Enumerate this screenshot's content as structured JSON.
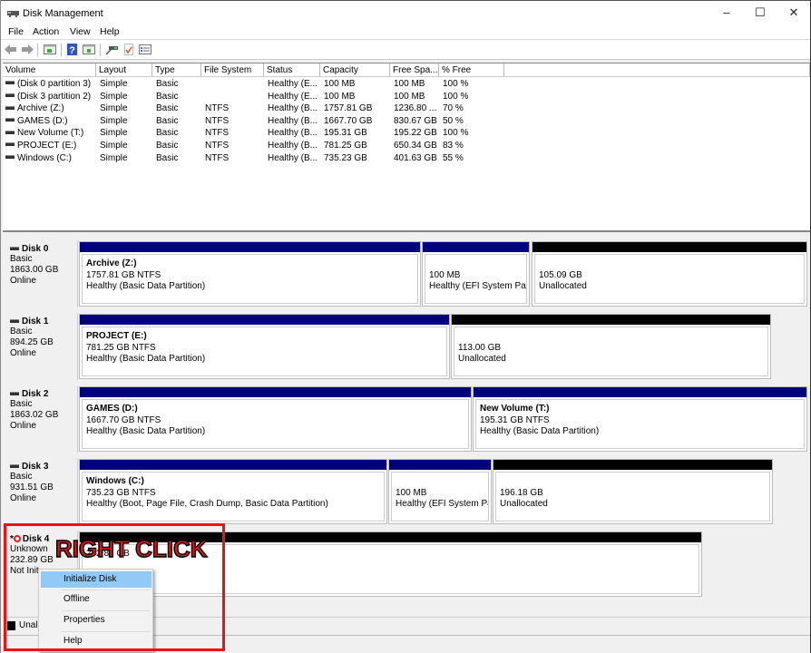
{
  "window": {
    "title": "Disk Management",
    "controls": {
      "minimize": "–",
      "maximize": "☐",
      "close": "✕"
    }
  },
  "menu": [
    "File",
    "Action",
    "View",
    "Help"
  ],
  "toolbar": {
    "icons": [
      "back-arrow-icon",
      "forward-arrow-icon",
      "show-hide-console-tree-icon",
      "help-icon",
      "show-hide-action-pane-icon",
      "connect-disk-icon",
      "checklist-icon",
      "properties-icon"
    ]
  },
  "volume_list": {
    "columns": [
      "Volume",
      "Layout",
      "Type",
      "File System",
      "Status",
      "Capacity",
      "Free Spa...",
      "% Free"
    ],
    "rows": [
      [
        "(Disk 0 partition 3)",
        "Simple",
        "Basic",
        "",
        "Healthy (E...",
        "100 MB",
        "100 MB",
        "100 %"
      ],
      [
        "(Disk 3 partition 2)",
        "Simple",
        "Basic",
        "",
        "Healthy (E...",
        "100 MB",
        "100 MB",
        "100 %"
      ],
      [
        "Archive (Z:)",
        "Simple",
        "Basic",
        "NTFS",
        "Healthy (B...",
        "1757.81 GB",
        "1236.80 ...",
        "70 %"
      ],
      [
        "GAMES (D:)",
        "Simple",
        "Basic",
        "NTFS",
        "Healthy (B...",
        "1667.70 GB",
        "830.67 GB",
        "50 %"
      ],
      [
        "New Volume (T:)",
        "Simple",
        "Basic",
        "NTFS",
        "Healthy (B...",
        "195.31 GB",
        "195.22 GB",
        "100 %"
      ],
      [
        "PROJECT (E:)",
        "Simple",
        "Basic",
        "NTFS",
        "Healthy (B...",
        "781.25 GB",
        "650.34 GB",
        "83 %"
      ],
      [
        "Windows (C:)",
        "Simple",
        "Basic",
        "NTFS",
        "Healthy (B...",
        "735.23 GB",
        "401.63 GB",
        "55 %"
      ]
    ]
  },
  "disks": [
    {
      "name": "Disk 0",
      "type": "Basic",
      "size": "1863.00 GB",
      "status": "Online",
      "partitions": [
        {
          "title": "Archive  (Z:)",
          "line1": "1757.81 GB NTFS",
          "line2": "Healthy (Basic Data Partition)",
          "bar": "blue"
        },
        {
          "title": "",
          "line1": "100 MB",
          "line2": "Healthy (EFI System Partit",
          "bar": "blue"
        },
        {
          "title": "",
          "line1": "105.09 GB",
          "line2": "Unallocated",
          "bar": "black"
        }
      ]
    },
    {
      "name": "Disk 1",
      "type": "Basic",
      "size": "894.25 GB",
      "status": "Online",
      "partitions": [
        {
          "title": "PROJECT  (E:)",
          "line1": "781.25 GB NTFS",
          "line2": "Healthy (Basic Data Partition)",
          "bar": "blue"
        },
        {
          "title": "",
          "line1": "113.00 GB",
          "line2": "Unallocated",
          "bar": "black"
        }
      ]
    },
    {
      "name": "Disk 2",
      "type": "Basic",
      "size": "1863.02 GB",
      "status": "Online",
      "partitions": [
        {
          "title": "GAMES  (D:)",
          "line1": "1667.70 GB NTFS",
          "line2": "Healthy (Basic Data Partition)",
          "bar": "blue"
        },
        {
          "title": "New Volume  (T:)",
          "line1": "195.31 GB NTFS",
          "line2": "Healthy (Basic Data Partition)",
          "bar": "blue"
        }
      ]
    },
    {
      "name": "Disk 3",
      "type": "Basic",
      "size": "931.51 GB",
      "status": "Online",
      "partitions": [
        {
          "title": "Windows  (C:)",
          "line1": "735.23 GB NTFS",
          "line2": "Healthy (Boot, Page File, Crash Dump, Basic Data Partition)",
          "bar": "blue"
        },
        {
          "title": "",
          "line1": "100 MB",
          "line2": "Healthy (EFI System Part",
          "bar": "blue"
        },
        {
          "title": "",
          "line1": "196.18 GB",
          "line2": "Unallocated",
          "bar": "black"
        }
      ]
    },
    {
      "name": "Disk 4",
      "type": "Unknown",
      "size": "232.89 GB",
      "status": "Not Init",
      "partitions": [
        {
          "title": "",
          "line1": "232.89 GB",
          "line2": "",
          "bar": "black"
        }
      ]
    }
  ],
  "legend": {
    "label": "Unall"
  },
  "context_menu": {
    "items": [
      "Initialize Disk",
      "Offline",
      "Properties",
      "Help"
    ],
    "highlighted": "Initialize Disk"
  },
  "annotation": {
    "text": "RIGHT CLICK",
    "color": "#ee1111"
  },
  "colors": {
    "primary_partition": "#00007f",
    "unallocated": "#000000",
    "menu_highlight": "#91c9f7"
  }
}
